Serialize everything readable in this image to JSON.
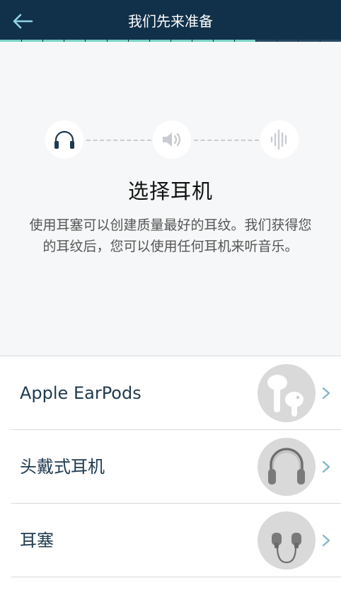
{
  "header": {
    "title": "我们先来准备",
    "back_icon": "arrow-left-icon",
    "progress_fraction": 0.75
  },
  "steps": {
    "icons": [
      "headphones-icon",
      "speaker-icon",
      "waveform-icon"
    ]
  },
  "intro": {
    "heading": "选择耳机",
    "description": "使用耳塞可以创建质量最好的耳纹。我们获得您的耳纹后，您可以使用任何耳机来听音乐。"
  },
  "options": [
    {
      "label": "Apple EarPods",
      "icon": "earpods-icon"
    },
    {
      "label": "头戴式耳机",
      "icon": "over-ear-headphones-icon"
    },
    {
      "label": "耳塞",
      "icon": "earbuds-icon"
    }
  ],
  "colors": {
    "header_bg": "#11304a",
    "progress_accent": "#7ad6c6",
    "chevron": "#7fb3c9"
  }
}
